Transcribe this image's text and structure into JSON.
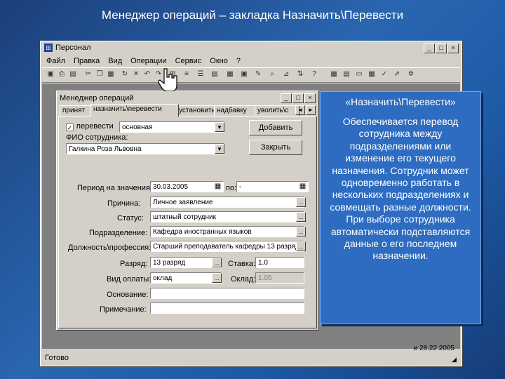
{
  "slide": {
    "title": "Менеджер операций – закладка Назначить\\Перевести"
  },
  "app": {
    "title": "Персонал",
    "window_buttons": [
      "_",
      "□",
      "×"
    ],
    "menu": [
      "Файл",
      "Правка",
      "Вид",
      "Операции",
      "Сервис",
      "Окно",
      "?"
    ],
    "status": "Готово",
    "status_date": "и 28.22.2005"
  },
  "dialog": {
    "title": "Менеджер операций",
    "window_buttons": [
      "_",
      "□",
      "×"
    ],
    "tabs": [
      "принят",
      "назначить\\перевести",
      "установить",
      "надбавку",
      "уволить\\с"
    ],
    "scroll_buttons": [
      "◄",
      "►"
    ],
    "form": {
      "translate_checkbox": "✓",
      "translate_label": "перевести",
      "translate_value": "основная",
      "fio_label": "ФИО сотрудника:",
      "fio_value": "Галкина Роза Львовна",
      "add_button": "Добавить",
      "close_button": "Закрыть",
      "period_label": "Период на значения:",
      "period_from": "30.03.2005",
      "period_to_label": "по:",
      "period_to": "-",
      "reason_label": "Причина:",
      "reason_value": "Личное заявление",
      "status_label": "Статус:",
      "status_value": "штатный сотрудник",
      "department_label": "Подразделение:",
      "department_value": "Кафедра иностранных языков",
      "position_label": "Должность\\профессия:",
      "position_value": "Старший преподаватель кафедры 13 разряд",
      "grade_label": "Разряд:",
      "grade_value": "13 разряд",
      "rate_label": "Ставка:",
      "rate_value": "1.0",
      "paytype_label": "Вид оплаты:",
      "paytype_value": "оклад",
      "salary_label": "Оклад:",
      "salary_value": "1.05",
      "basis_label": "Основание:",
      "basis_value": "",
      "note_label": "Примечание:",
      "note_value": "",
      "ellipsis": "...",
      "dropdown_arrow": "▼"
    }
  },
  "callout": {
    "title": "«Назначить\\Перевести»",
    "body": "Обеспечивается перевод сотрудника между подразделениями или изменение его текущего назначения. Сотрудник может одновременно работать в нескольких подразделениях и совмещать разные должности. При выборе сотрудника автоматически подставляются данные о его последнем назначении."
  },
  "icons": [
    "app-icon",
    "save-icon",
    "print-icon",
    "cut-icon",
    "copy-icon",
    "paste-icon",
    "calendar-icon",
    "hand-cursor-icon"
  ]
}
